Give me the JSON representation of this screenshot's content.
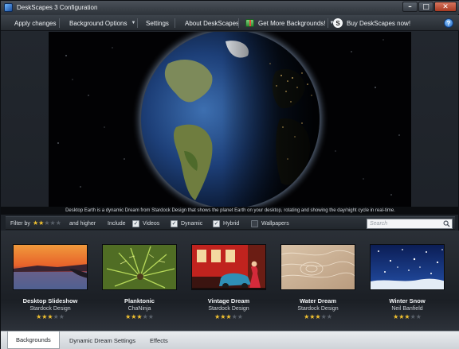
{
  "window": {
    "title": "DeskScapes 3 Configuration"
  },
  "menu": {
    "apply": "Apply changes",
    "background_options": "Background Options",
    "settings": "Settings",
    "about": "About DeskScapes",
    "get_more": "Get More Backgrounds!",
    "buy": "Buy DeskScapes now!"
  },
  "preview": {
    "caption": "Desktop Earth is a dynamic Dream from Stardock Design that shows the planet Earth on your desktop, rotating and showing the day/night cycle in real-time."
  },
  "filter": {
    "filter_by": "Filter by",
    "rating": 2,
    "and_higher": "and higher",
    "include": "Include",
    "videos": "Videos",
    "videos_checked": true,
    "dynamic": "Dynamic",
    "dynamic_checked": true,
    "hybrid": "Hybrid",
    "hybrid_checked": true,
    "wallpapers": "Wallpapers",
    "wallpapers_checked": false,
    "search_placeholder": "Search"
  },
  "backgrounds": [
    {
      "title": "Desktop Slideshow",
      "author": "Stardock Design",
      "rating": 3
    },
    {
      "title": "Planktonic",
      "author": "ChaNinja",
      "rating": 3
    },
    {
      "title": "Vintage Dream",
      "author": "Stardock Design",
      "rating": 3
    },
    {
      "title": "Water Dream",
      "author": "Stardock Design",
      "rating": 3
    },
    {
      "title": "Winter Snow",
      "author": "Neil Banfield",
      "rating": 3
    }
  ],
  "tabs": [
    "Backgrounds",
    "Dynamic Dream Settings",
    "Effects"
  ],
  "active_tab": 0,
  "colors": {
    "star_on": "#f2c230",
    "star_off": "#5a616a",
    "accent": "#2f7be0"
  }
}
